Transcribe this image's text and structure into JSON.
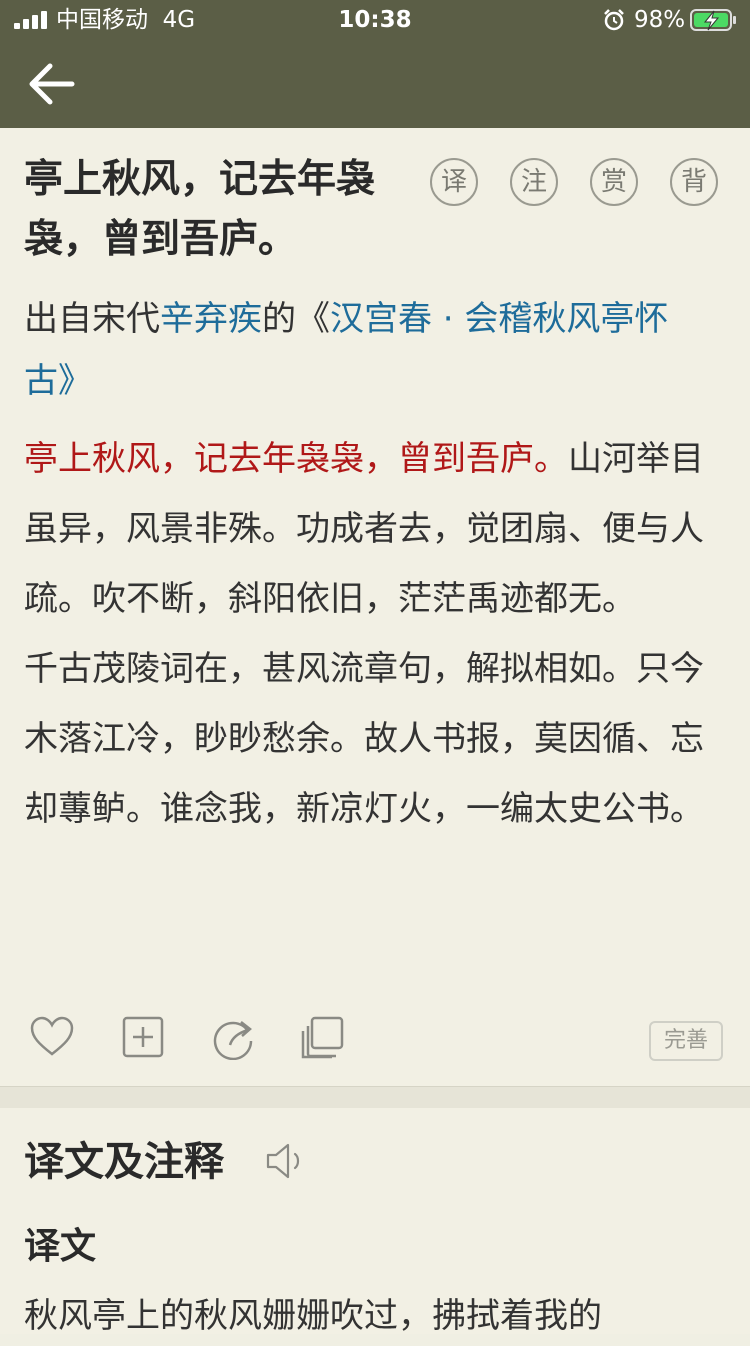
{
  "status": {
    "carrier": "中国移动",
    "network": "4G",
    "time": "10:38",
    "battery": "98%"
  },
  "nav": {
    "back_icon": "arrow-left-icon"
  },
  "poem": {
    "title": "亭上秋风，记去年袅袅，曾到吾庐。",
    "pills": [
      "译",
      "注",
      "赏",
      "背"
    ],
    "source_prefix": "出自宋代",
    "author": "辛弃疾",
    "source_mid": "的《",
    "work": "汉宫春 · 会稽秋风亭怀古",
    "source_suffix": "》",
    "highlight": "亭上秋风，记去年袅袅，曾到吾庐。",
    "rest1": "山河举目虽异，风景非殊。功成者去，觉团扇、便与人疏。吹不断，斜阳依旧，茫茫禹迹都无。",
    "rest2": "千古茂陵词在，甚风流章句，解拟相如。只今木落江冷，眇眇愁余。故人书报，莫因循、忘却蓴鲈。谁念我，新凉灯火，一编太史公书。"
  },
  "actions": {
    "icons": [
      "heart-icon",
      "add-icon",
      "share-icon",
      "copy-icon"
    ],
    "improve_label": "完善"
  },
  "section": {
    "title": "译文及注释",
    "subtitle": "译文",
    "text": "秋风亭上的秋风姗姗吹过，拂拭着我的"
  },
  "colors": {
    "header": "#5b5e46",
    "background": "#f2f0e4",
    "link": "#1e6c9a",
    "highlight": "#b01818"
  }
}
